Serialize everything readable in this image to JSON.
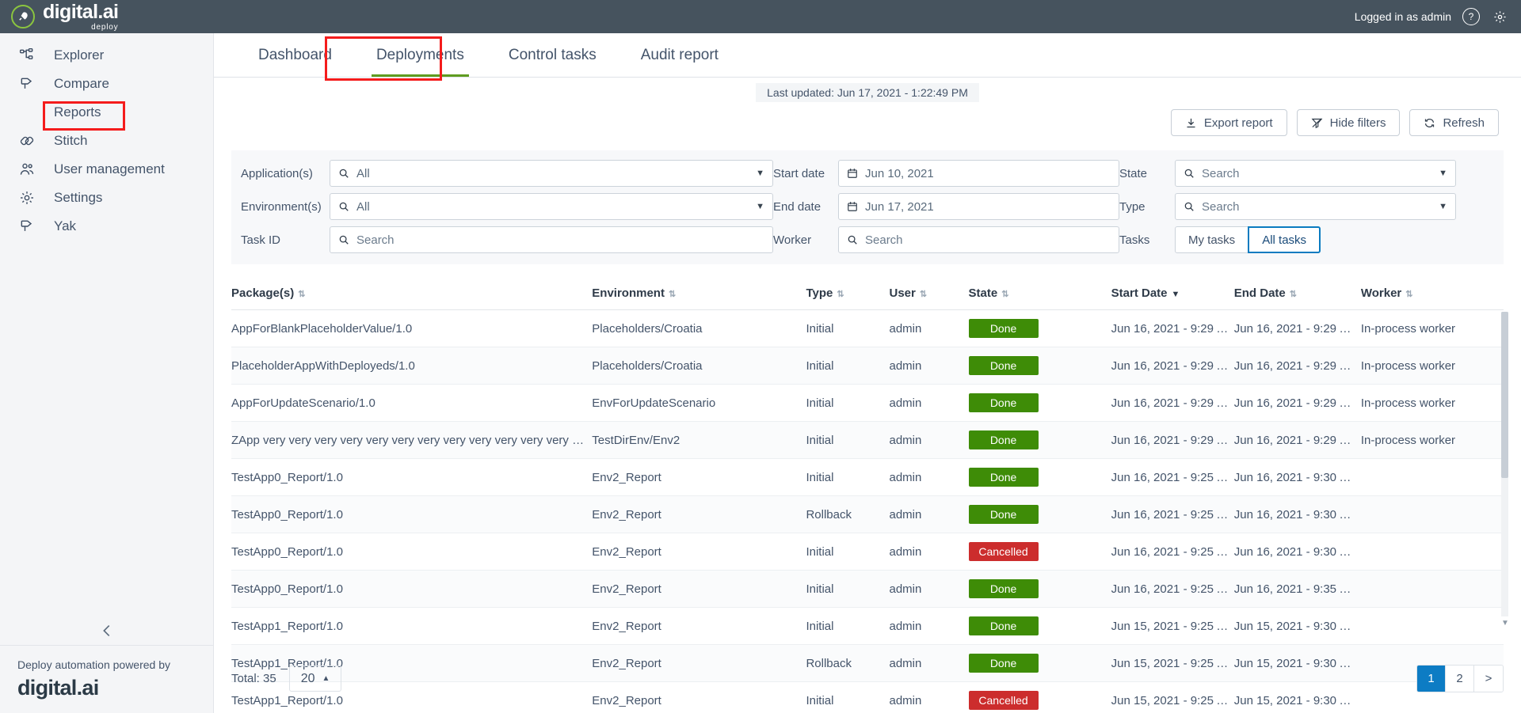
{
  "topbar": {
    "brand_name": "digital.ai",
    "brand_sub": "deploy",
    "logged_in": "Logged in as admin",
    "help_icon": "help-circle-icon",
    "settings_icon": "gear-icon",
    "rocket_icon": "rocket-icon"
  },
  "sidebar": {
    "items": [
      {
        "label": "Explorer",
        "icon": "sitemap-icon"
      },
      {
        "label": "Compare",
        "icon": "compare-icon"
      },
      {
        "label": "Reports",
        "icon": "none"
      },
      {
        "label": "Stitch",
        "icon": "stitch-icon"
      },
      {
        "label": "User management",
        "icon": "users-icon"
      },
      {
        "label": "Settings",
        "icon": "gear-icon"
      },
      {
        "label": "Yak",
        "icon": "yak-icon"
      }
    ],
    "collapse_icon": "chevron-left-icon",
    "footer_text": "Deploy automation powered by",
    "footer_logo": "digital.ai"
  },
  "tabs": [
    {
      "label": "Dashboard",
      "active": false
    },
    {
      "label": "Deployments",
      "active": true
    },
    {
      "label": "Control tasks",
      "active": false
    },
    {
      "label": "Audit report",
      "active": false
    }
  ],
  "header": {
    "last_updated": "Last updated: Jun 17, 2021 - 1:22:49 PM",
    "export_label": "Export report",
    "hide_filters_label": "Hide filters",
    "refresh_label": "Refresh",
    "export_icon": "download-icon",
    "hide_filters_icon": "filter-slash-icon",
    "refresh_icon": "refresh-icon"
  },
  "filters": {
    "applications_label": "Application(s)",
    "applications_value": "All",
    "environments_label": "Environment(s)",
    "environments_value": "All",
    "taskid_label": "Task ID",
    "taskid_placeholder": "Search",
    "startdate_label": "Start date",
    "startdate_value": "Jun 10, 2021",
    "enddate_label": "End date",
    "enddate_value": "Jun 17, 2021",
    "worker_label": "Worker",
    "worker_placeholder": "Search",
    "state_label": "State",
    "state_placeholder": "Search",
    "type_label": "Type",
    "type_placeholder": "Search",
    "tasks_label": "Tasks",
    "tasks_options": [
      "My tasks",
      "All tasks"
    ],
    "tasks_selected": "All tasks",
    "search_icon": "search-icon",
    "calendar_icon": "calendar-icon",
    "caret_icon": "chevron-down-icon"
  },
  "table": {
    "columns": [
      {
        "label": "Package(s)",
        "sorted": false
      },
      {
        "label": "Environment",
        "sorted": false
      },
      {
        "label": "Type",
        "sorted": false
      },
      {
        "label": "User",
        "sorted": false
      },
      {
        "label": "State",
        "sorted": false
      },
      {
        "label": "Start Date",
        "sorted": true
      },
      {
        "label": "End Date",
        "sorted": false
      },
      {
        "label": "Worker",
        "sorted": false
      }
    ],
    "rows": [
      {
        "package": "AppForBlankPlaceholderValue/1.0",
        "environment": "Placeholders/Croatia",
        "type": "Initial",
        "user": "admin",
        "state": "Done",
        "start": "Jun 16, 2021 - 9:29 A…",
        "end": "Jun 16, 2021 - 9:29 A…",
        "worker": "In-process worker"
      },
      {
        "package": "PlaceholderAppWithDeployeds/1.0",
        "environment": "Placeholders/Croatia",
        "type": "Initial",
        "user": "admin",
        "state": "Done",
        "start": "Jun 16, 2021 - 9:29 A…",
        "end": "Jun 16, 2021 - 9:29 A…",
        "worker": "In-process worker"
      },
      {
        "package": "AppForUpdateScenario/1.0",
        "environment": "EnvForUpdateScenario",
        "type": "Initial",
        "user": "admin",
        "state": "Done",
        "start": "Jun 16, 2021 - 9:29 A…",
        "end": "Jun 16, 2021 - 9:29 A…",
        "worker": "In-process worker"
      },
      {
        "package": "ZApp very very very very very very very very very very very very very…",
        "environment": "TestDirEnv/Env2",
        "type": "Initial",
        "user": "admin",
        "state": "Done",
        "start": "Jun 16, 2021 - 9:29 A…",
        "end": "Jun 16, 2021 - 9:29 A…",
        "worker": "In-process worker"
      },
      {
        "package": "TestApp0_Report/1.0",
        "environment": "Env2_Report",
        "type": "Initial",
        "user": "admin",
        "state": "Done",
        "start": "Jun 16, 2021 - 9:25 A…",
        "end": "Jun 16, 2021 - 9:30 A…",
        "worker": ""
      },
      {
        "package": "TestApp0_Report/1.0",
        "environment": "Env2_Report",
        "type": "Rollback",
        "user": "admin",
        "state": "Done",
        "start": "Jun 16, 2021 - 9:25 A…",
        "end": "Jun 16, 2021 - 9:30 A…",
        "worker": ""
      },
      {
        "package": "TestApp0_Report/1.0",
        "environment": "Env2_Report",
        "type": "Initial",
        "user": "admin",
        "state": "Cancelled",
        "start": "Jun 16, 2021 - 9:25 A…",
        "end": "Jun 16, 2021 - 9:30 A…",
        "worker": ""
      },
      {
        "package": "TestApp0_Report/1.0",
        "environment": "Env2_Report",
        "type": "Initial",
        "user": "admin",
        "state": "Done",
        "start": "Jun 16, 2021 - 9:25 A…",
        "end": "Jun 16, 2021 - 9:35 A…",
        "worker": ""
      },
      {
        "package": "TestApp1_Report/1.0",
        "environment": "Env2_Report",
        "type": "Initial",
        "user": "admin",
        "state": "Done",
        "start": "Jun 15, 2021 - 9:25 A…",
        "end": "Jun 15, 2021 - 9:30 A…",
        "worker": ""
      },
      {
        "package": "TestApp1_Report/1.0",
        "environment": "Env2_Report",
        "type": "Rollback",
        "user": "admin",
        "state": "Done",
        "start": "Jun 15, 2021 - 9:25 A…",
        "end": "Jun 15, 2021 - 9:30 A…",
        "worker": ""
      },
      {
        "package": "TestApp1_Report/1.0",
        "environment": "Env2_Report",
        "type": "Initial",
        "user": "admin",
        "state": "Cancelled",
        "start": "Jun 15, 2021 - 9:25 A…",
        "end": "Jun 15, 2021 - 9:30 A…",
        "worker": ""
      }
    ]
  },
  "pagination": {
    "total_label": "Total: 35",
    "page_size": "20",
    "page_size_caret": "chevron-up-icon",
    "pages": [
      "1",
      "2",
      ">"
    ],
    "current_page": "1"
  },
  "colors": {
    "accent_green": "#5f9c20",
    "done_green": "#3e8c07",
    "cancelled_red": "#cc2d2d",
    "annotation_red": "#f41c1c",
    "pager_blue": "#0d7cc4",
    "topbar_dark": "#46535e"
  }
}
